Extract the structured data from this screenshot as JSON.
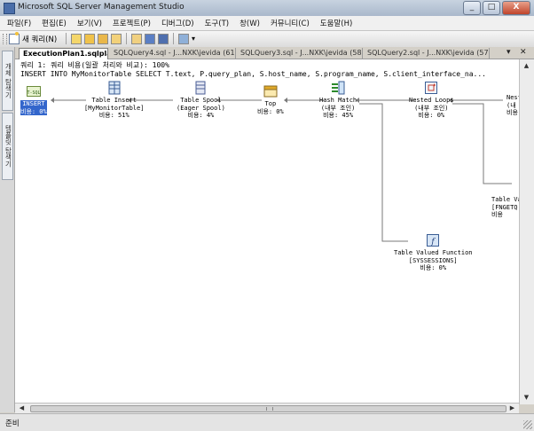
{
  "window": {
    "title": "Microsoft SQL Server Management Studio",
    "min": "_",
    "max": "□",
    "close": "X"
  },
  "menu": [
    "파일(F)",
    "편집(E)",
    "보기(V)",
    "프로젝트(P)",
    "디버그(D)",
    "도구(T)",
    "창(W)",
    "커뮤니티(C)",
    "도움말(H)"
  ],
  "toolbar": {
    "new_query": "새 쿼리(N)"
  },
  "side_tabs": [
    "개체 탐색기",
    "템플릿 탐색기"
  ],
  "tabs": [
    {
      "label": "ExecutionPlan1.sqlplan*",
      "active": true
    },
    {
      "label": "SQLQuery4.sql - J...NXK\\jevida (61))*",
      "active": false
    },
    {
      "label": "SQLQuery3.sql - J...NXK\\jevida (58))*",
      "active": false
    },
    {
      "label": "SQLQuery2.sql - J...NXK\\jevida (57))*",
      "active": false
    }
  ],
  "tab_controls": {
    "dropdown": "▾",
    "close": "✕"
  },
  "plan_header": {
    "line1": "쿼리 1: 쿼리 비용(일괄 처리와 비교): 100%",
    "line2": "INSERT INTO MyMonitorTable SELECT T.text, P.query_plan, S.host_name, S.program_name, S.client_interface_na..."
  },
  "nodes": [
    {
      "id": "insert",
      "icon": "tsql-insert-icon",
      "lines": [
        "INSERT",
        "비용: 0%"
      ],
      "selected": true
    },
    {
      "id": "table-insert",
      "icon": "table-insert-icon",
      "lines": [
        "Table Insert",
        "[MyMonitorTable]",
        "비용: 51%"
      ]
    },
    {
      "id": "table-spool",
      "icon": "table-spool-icon",
      "lines": [
        "Table Spool",
        "(Eager Spool)",
        "비용: 4%"
      ]
    },
    {
      "id": "top",
      "icon": "top-icon",
      "lines": [
        "Top",
        "비용: 0%"
      ]
    },
    {
      "id": "hash-match",
      "icon": "hash-match-icon",
      "lines": [
        "Hash Match",
        "(내부 조인)",
        "비용: 45%"
      ]
    },
    {
      "id": "nested-loops",
      "icon": "nested-loops-icon",
      "lines": [
        "Nested Loops",
        "(내부 조인)",
        "비용: 0%"
      ]
    },
    {
      "id": "nested-loops-2",
      "icon": "nested-loops-icon",
      "lines": [
        "Neste",
        "(내",
        "비용"
      ]
    },
    {
      "id": "tvf-1",
      "icon": "table-valued-function-icon",
      "lines": [
        "Table Valu",
        "[FNGETQ",
        "비용"
      ]
    },
    {
      "id": "tvf-sessions",
      "icon": "table-valued-function-icon",
      "lines": [
        "Table Valued Function",
        "[SYSSESSIONS]",
        "비용: 0%"
      ]
    }
  ],
  "status": {
    "text": "준비"
  },
  "colors": {
    "selection": "#3366cc",
    "link": "#7a7a7a"
  }
}
